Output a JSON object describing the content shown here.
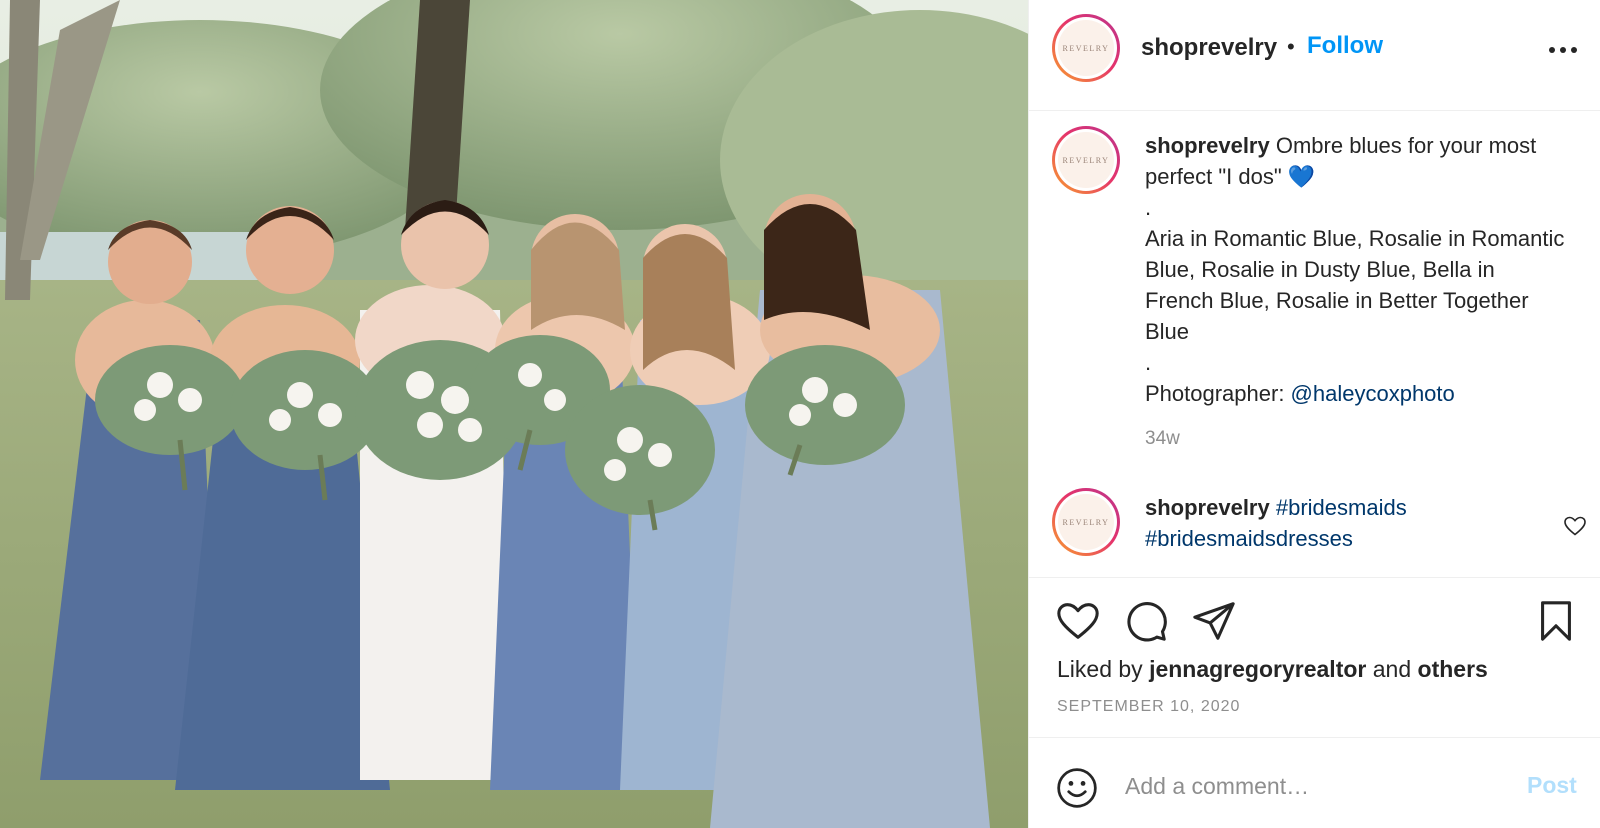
{
  "post": {
    "image_alt": "Bridesmaids in ombre blue dresses with bride holding bouquets",
    "header": {
      "avatar_text": "REVELRY",
      "username": "shoprevelry",
      "separator": "•",
      "follow_label": "Follow"
    },
    "caption": {
      "username": "shoprevelry",
      "line1": " Ombre blues for your most perfect \"I dos\" 💙",
      "dot1": ".",
      "line2": "Aria in Romantic Blue, Rosalie in Romantic Blue, Rosalie in Dusty Blue, Bella in French Blue, Rosalie in Better Together Blue",
      "dot2": ".",
      "photographer_label": "Photographer: ",
      "photographer_handle": "@haleycoxphoto",
      "time": "34w"
    },
    "comment": {
      "username": "shoprevelry",
      "tag1": "#bridesmaids",
      "tag2": "#bridesmaidsdresses"
    },
    "likes": {
      "prefix": "Liked by ",
      "user": "jennagregoryrealtor",
      "middle": " and ",
      "others": "others"
    },
    "date": "SEPTEMBER 10, 2020",
    "add_comment": {
      "placeholder": "Add a comment…",
      "post_label": "Post"
    }
  },
  "icons": {
    "more": "more-options-icon",
    "like": "heart-icon",
    "comment": "comment-icon",
    "share": "paper-plane-icon",
    "save": "bookmark-icon",
    "emoji": "emoji-icon"
  },
  "colors": {
    "follow": "#0095f6",
    "link": "#00376b",
    "post_disabled": "#b2dffc",
    "muted": "#8e8e8e"
  }
}
